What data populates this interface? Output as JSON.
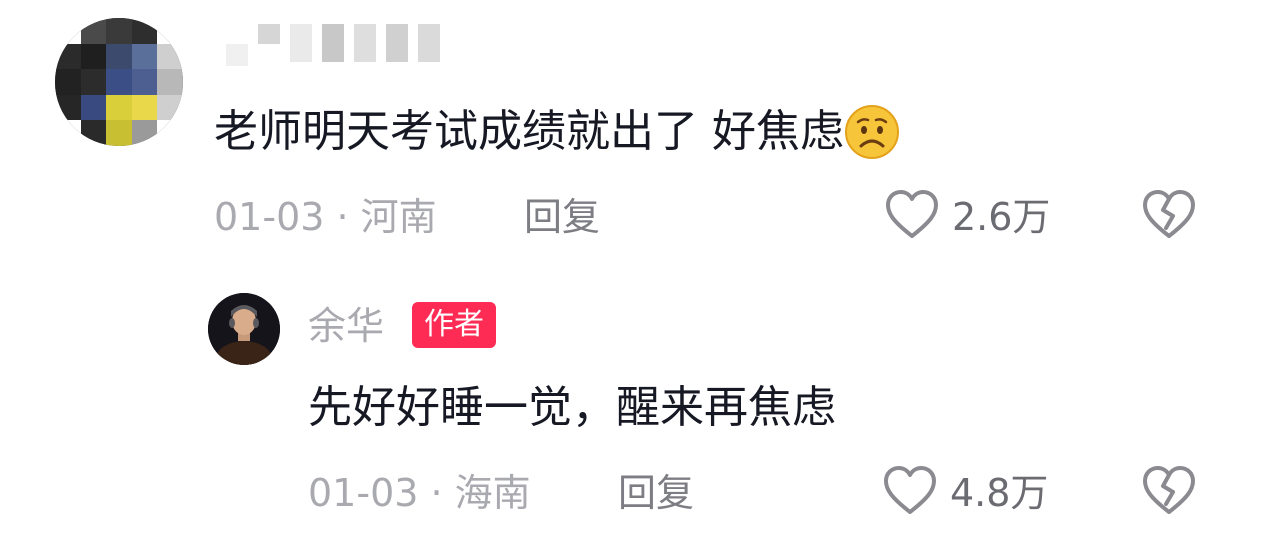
{
  "comments": [
    {
      "username": "",
      "text": "老师明天考试成绩就出了 好焦虑",
      "emoji": "worried-face-icon",
      "date_location": "01-03 · 河南",
      "reply_label": "回复",
      "like_count": "2.6万"
    }
  ],
  "reply": {
    "username": "余华",
    "badge": "作者",
    "text": "先好好睡一觉，醒来再焦虑",
    "date_location": "01-03 · 海南",
    "reply_label": "回复",
    "like_count": "4.8万"
  },
  "colors": {
    "badge": "#fe2c55",
    "text": "#161823",
    "meta": "#a9a9b0"
  }
}
